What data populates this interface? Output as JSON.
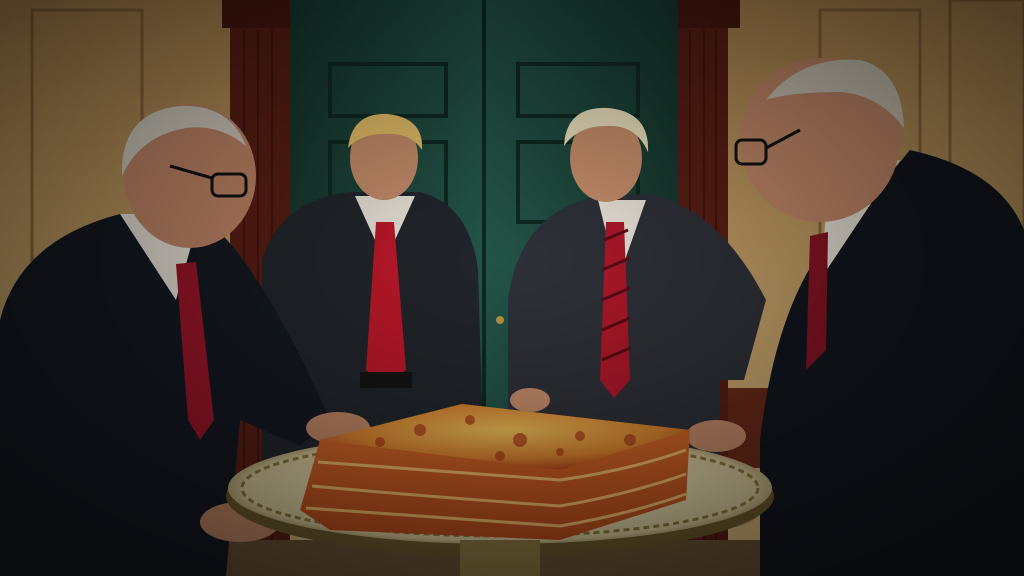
{
  "scene": {
    "kind": "photograph",
    "subject": "four-men-in-suits-around-lasagna",
    "colors": {
      "wall": "#c9a56a",
      "door": "#1f4a3c",
      "door_frame": "#5a1f15",
      "suit_dark": "#141820",
      "suit_grey": "#2a2d33",
      "tie_red": "#b0182a",
      "platter": "#d9cfa8",
      "lasagna": "#d0662a",
      "cheese": "#e8b24a",
      "skin": "#c98f6c"
    }
  }
}
